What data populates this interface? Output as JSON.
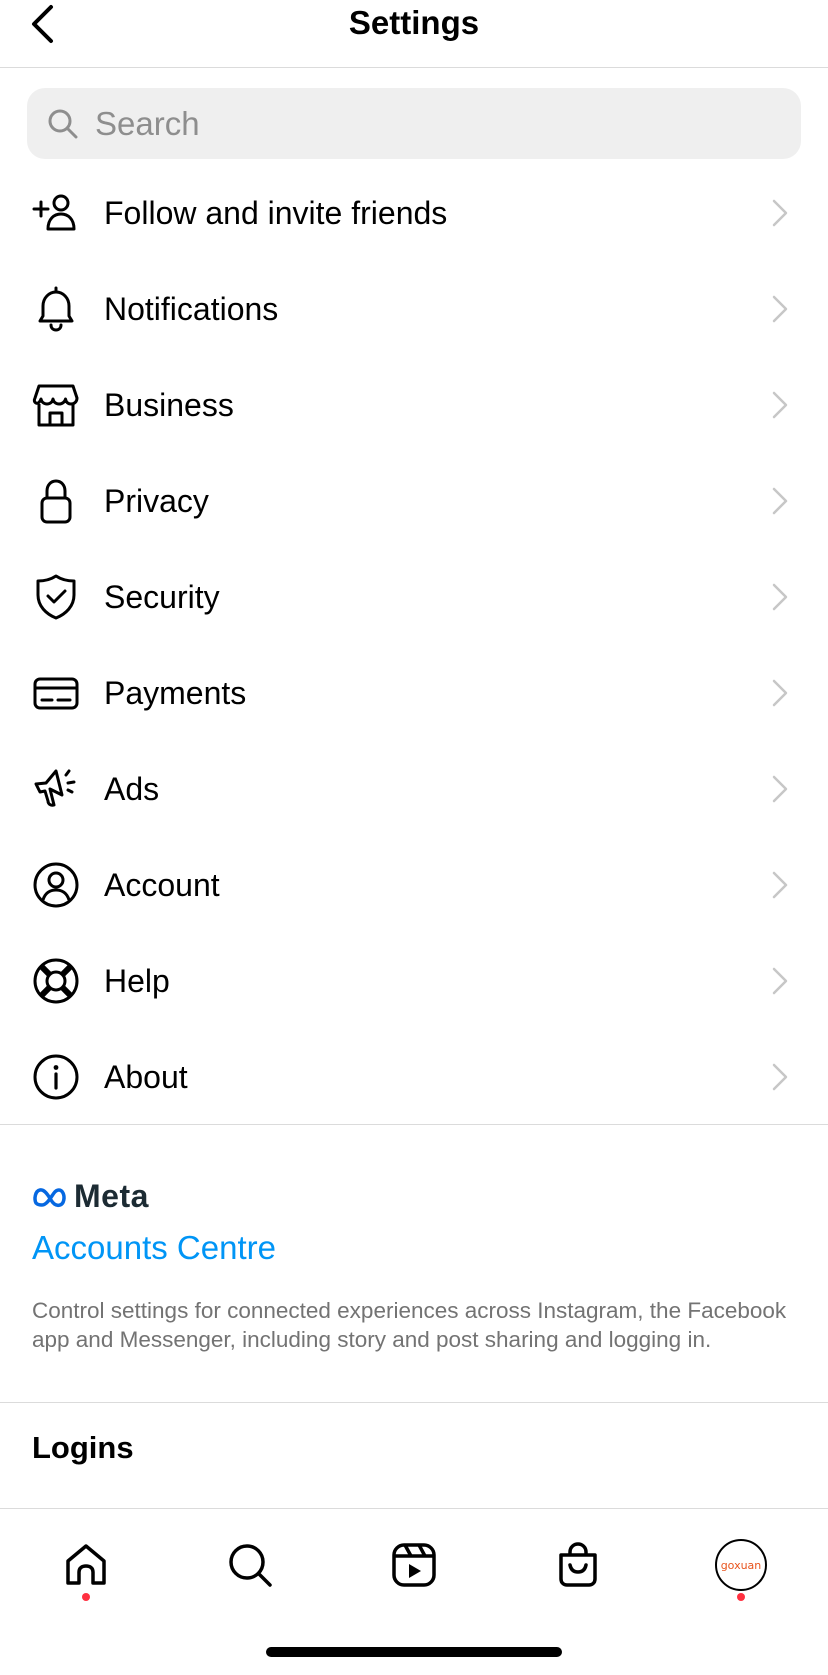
{
  "header": {
    "title": "Settings",
    "back_icon": "chevron-left-icon"
  },
  "search": {
    "placeholder": "Search",
    "icon": "search-icon"
  },
  "menu": {
    "items": [
      {
        "label": "Follow and invite friends",
        "icon": "add-person-icon"
      },
      {
        "label": "Notifications",
        "icon": "bell-icon"
      },
      {
        "label": "Business",
        "icon": "storefront-icon"
      },
      {
        "label": "Privacy",
        "icon": "lock-icon"
      },
      {
        "label": "Security",
        "icon": "shield-check-icon"
      },
      {
        "label": "Payments",
        "icon": "card-icon"
      },
      {
        "label": "Ads",
        "icon": "megaphone-icon"
      },
      {
        "label": "Account",
        "icon": "account-circle-icon"
      },
      {
        "label": "Help",
        "icon": "lifebuoy-icon"
      },
      {
        "label": "About",
        "icon": "info-icon"
      }
    ]
  },
  "meta": {
    "brand": "Meta",
    "accounts_centre": "Accounts Centre",
    "description": "Control settings for connected experiences across Instagram, the Facebook app and Messenger, including story and post sharing and logging in."
  },
  "logins": {
    "title": "Logins"
  },
  "tabbar": {
    "tabs": [
      {
        "name": "home",
        "icon": "home-icon",
        "has_dot": true
      },
      {
        "name": "search",
        "icon": "search-icon",
        "has_dot": false
      },
      {
        "name": "reels",
        "icon": "reels-icon",
        "has_dot": false
      },
      {
        "name": "shop",
        "icon": "shopping-bag-icon",
        "has_dot": false
      },
      {
        "name": "profile",
        "icon": "avatar",
        "has_dot": true
      }
    ],
    "avatar_text": "goxuan"
  },
  "colors": {
    "accent_link": "#0095f6",
    "notification_dot": "#ff3040",
    "secondary_text": "#737373",
    "search_bg": "#efefef",
    "chevron": "#c7c7c7",
    "meta_blue": "#0668e1"
  }
}
